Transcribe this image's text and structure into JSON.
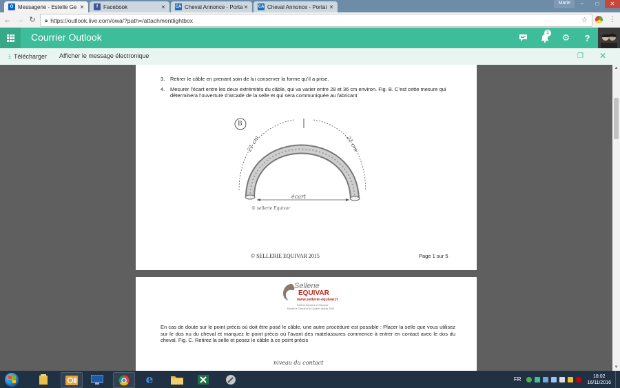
{
  "browser": {
    "tabs": [
      {
        "label": "Messagerie - Estelle Ge",
        "icon": "outlook-icon",
        "active": true
      },
      {
        "label": "Facebook",
        "icon": "facebook-icon",
        "active": false
      },
      {
        "label": "Cheval Annonce - Portai",
        "icon": "ca-icon",
        "active": false
      },
      {
        "label": "Cheval Annonce - Portai",
        "icon": "ca-icon",
        "active": false
      }
    ],
    "profile": "Marie",
    "url": "https://outlook.live.com/owa/?path=/attachmentlightbox"
  },
  "outlook": {
    "title": "Courrier Outlook",
    "notification_count": "1",
    "toolbar": {
      "download_label": "Télécharger",
      "show_message_label": "Afficher le message électronique"
    }
  },
  "document": {
    "page1": {
      "items": [
        {
          "num": "3.",
          "text": "Retirer le câble en prenant soin de lui conserver la forme qu’il a prise."
        },
        {
          "num": "4.",
          "text": "Mesurer l’écart entre les deux extrémités du câble, qui va varier entre 28 et 36 cm environ. Fig. B. C’est cette mesure qui déterminera l’ouverture d’arcade de la selle et qui sera communiquée au fabricant"
        }
      ],
      "figure": {
        "label": "B",
        "left_measure": "21 cm",
        "right_measure": "21 cm",
        "gap_label": "écart",
        "credit": "© sellerie Equivar"
      },
      "footer_copyright": "© SELLERIE EQUIVAR 2015",
      "footer_page": "Page 1 sur 5"
    },
    "page2": {
      "logo": {
        "line1": "Sellerie",
        "line2": "EQUIVAR",
        "url": "www.sellerie-equivar.fr",
        "tagline1": "Sellerie Equestre et Harnaise",
        "tagline2": "Equipe le Cheval et le Cavalier depuis 2000"
      },
      "paragraph": "En cas de doute sur le point précis où doit être posé le câble, une autre procédure est possible : Placer la selle que vous utilisez sur le dos nu du cheval et marquez le point précis où l’avant des matelassures commence à entrer en contact avec le dos du cheval. Fig. C. Retirez la selle et posez le câble à ce point précis",
      "handwritten": "niveau du contact"
    }
  },
  "taskbar": {
    "language": "FR",
    "time": "18:02",
    "date": "16/11/2016"
  },
  "colors": {
    "outlook_green": "#3dbd9a",
    "taskbar": "#213144",
    "tab_strip": "#6d8ca8"
  }
}
